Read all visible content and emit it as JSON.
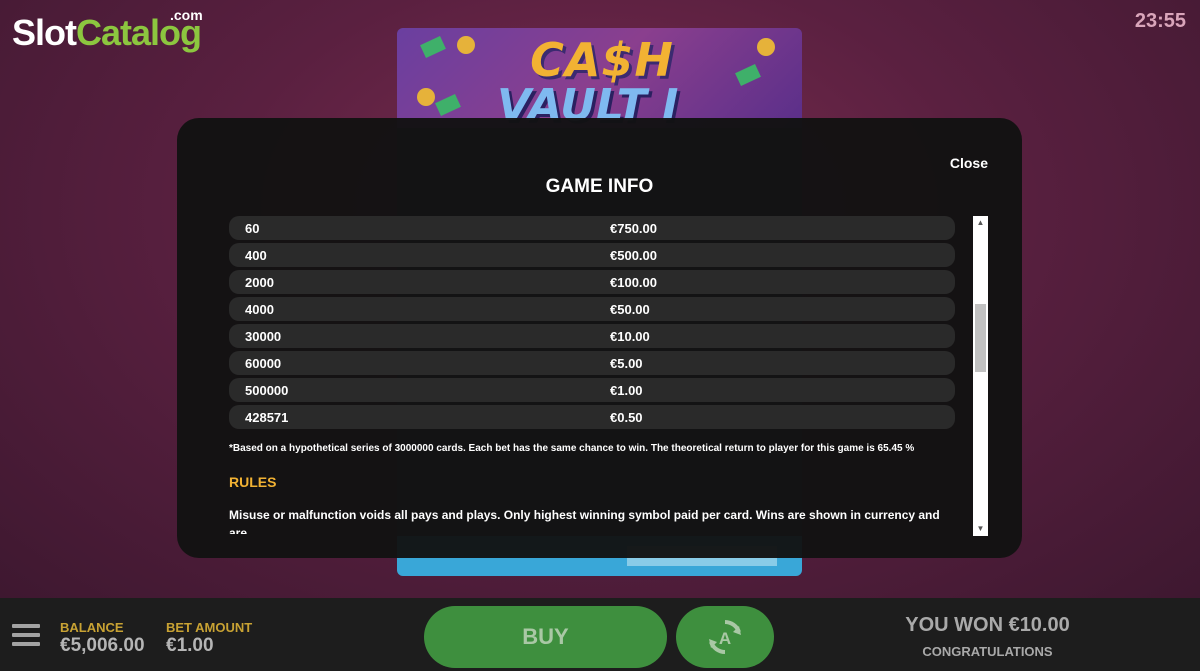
{
  "logo": {
    "part1": "Slot",
    "part2": "Catalog",
    "suffix": ".com"
  },
  "clock": "23:55",
  "game": {
    "title_line1": "CA$H",
    "title_line2": "VAULT I"
  },
  "modal": {
    "title": "GAME INFO",
    "close_label": "Close",
    "paytable": [
      {
        "count": "60",
        "prize": "€750.00"
      },
      {
        "count": "400",
        "prize": "€500.00"
      },
      {
        "count": "2000",
        "prize": "€100.00"
      },
      {
        "count": "4000",
        "prize": "€50.00"
      },
      {
        "count": "30000",
        "prize": "€10.00"
      },
      {
        "count": "60000",
        "prize": "€5.00"
      },
      {
        "count": "500000",
        "prize": "€1.00"
      },
      {
        "count": "428571",
        "prize": "€0.50"
      }
    ],
    "footnote": "*Based on a hypothetical series of 3000000 cards. Each bet has the same chance to win. The theoretical return to player for this game is 65.45 %",
    "rules_heading": "RULES",
    "rules_text": "Misuse or malfunction voids all pays and plays. Only highest winning symbol paid per card. Wins are shown in currency and are"
  },
  "bottom_bar": {
    "balance_label": "BALANCE",
    "balance_value": "€5,006.00",
    "bet_label": "BET AMOUNT",
    "bet_value": "€1.00",
    "buy_label": "BUY",
    "won_text": "YOU WON €10.00",
    "congrats_text": "CONGRATULATIONS"
  },
  "colors": {
    "accent_gold": "#f2b233",
    "button_green": "#3e8f3e",
    "logo_green": "#8cc63f"
  },
  "icons": [
    "menu-icon",
    "autoplay-icon",
    "scroll-up-icon",
    "scroll-down-icon"
  ]
}
